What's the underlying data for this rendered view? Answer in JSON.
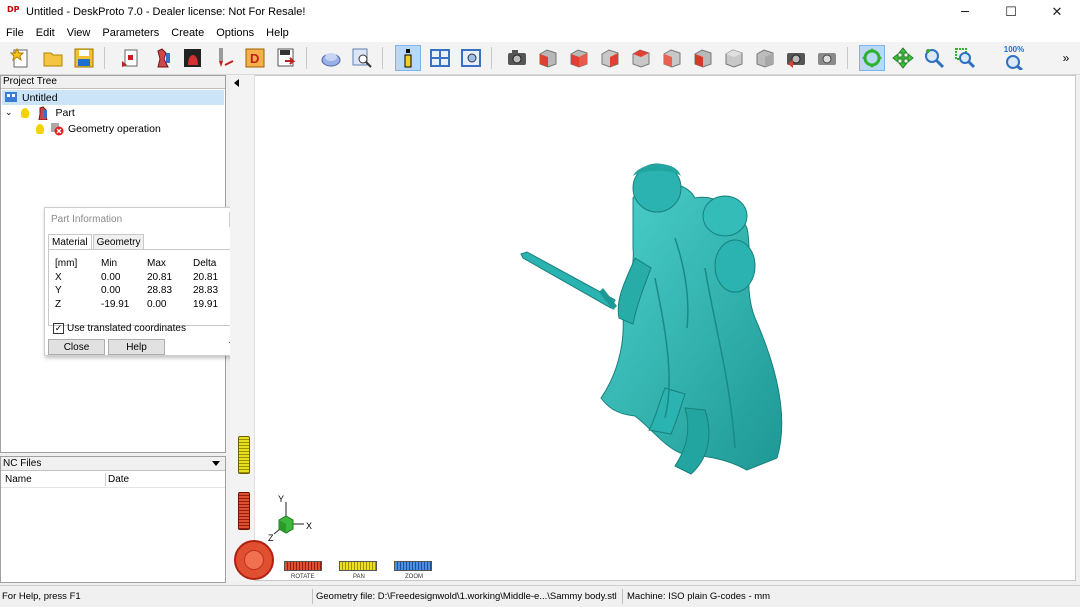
{
  "window": {
    "app_icon_text": "DP",
    "title": "Untitled - DeskProto 7.0 - Dealer license: Not For Resale!",
    "minimize": "─",
    "maximize": "☐",
    "close": "✕"
  },
  "menu": [
    "File",
    "Edit",
    "View",
    "Parameters",
    "Create",
    "Options",
    "Help"
  ],
  "toolbar": {
    "zoom_label": "100%",
    "overflow": "»",
    "colors": {
      "active_bg": "#b8d8f5",
      "red_cube": "#e04030",
      "gray_cube": "#b8b8b8"
    }
  },
  "project_tree": {
    "header": "Project Tree",
    "root": "Untitled",
    "part": "Part",
    "operation": "Geometry operation"
  },
  "part_info": {
    "title": "Part Information",
    "tabs": [
      "Material",
      "Geometry"
    ],
    "table": {
      "headers": [
        "[mm]",
        "Min",
        "Max",
        "Delta"
      ],
      "rows": [
        [
          "X",
          "0.00",
          "20.81",
          "20.81"
        ],
        [
          "Y",
          "0.00",
          "28.83",
          "28.83"
        ],
        [
          "Z",
          "-19.91",
          "0.00",
          "19.91"
        ]
      ]
    },
    "checkbox_label": "Use translated coordinates",
    "checkbox_checked": true,
    "close_button": "Close",
    "help_button": "Help"
  },
  "nc_files": {
    "header": "NC Files",
    "columns": [
      "Name",
      "Date"
    ]
  },
  "viewport": {
    "model_color": "#2ab3b0",
    "axes": {
      "y": "Y",
      "x": "X",
      "z": "Z"
    },
    "controls": [
      "ROTATE",
      "PAN",
      "ZOOM"
    ]
  },
  "status": {
    "help": "For Help, press F1",
    "geometry_file": "Geometry file: D:\\Freedesignwold\\1.working\\Middle-e...\\Sammy body.stl",
    "machine": "Machine: ISO plain G-codes - mm"
  }
}
